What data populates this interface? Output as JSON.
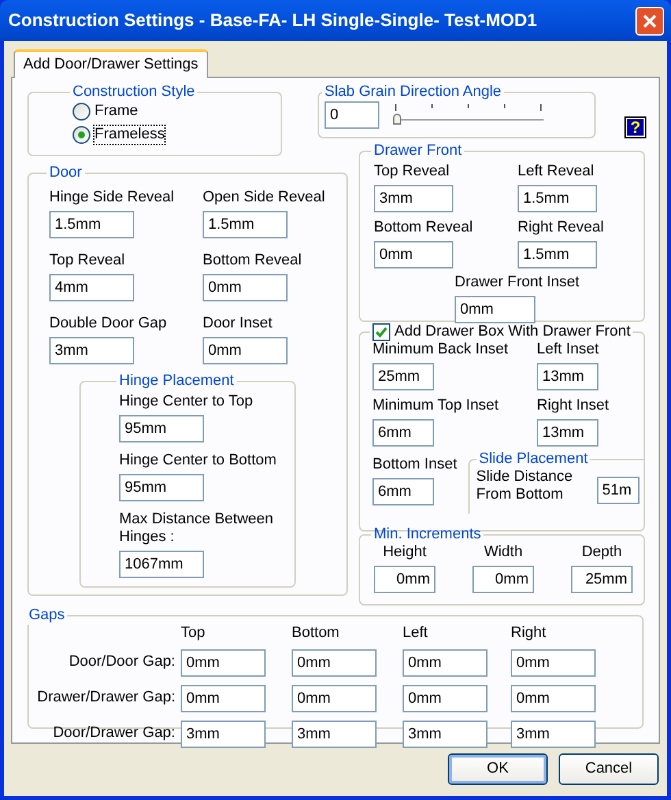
{
  "window": {
    "title": "Construction Settings - Base-FA- LH Single-Single- Test-MOD1"
  },
  "tabs": [
    {
      "label": "Add Door/Drawer Settings",
      "selected": true
    }
  ],
  "construction_style": {
    "title": "Construction Style",
    "options": [
      {
        "label": "Frame",
        "selected": false
      },
      {
        "label": "Frameless",
        "selected": true
      }
    ]
  },
  "slab_grain": {
    "title": "Slab Grain Direction Angle",
    "value": "0",
    "level": 0
  },
  "help_button": {
    "label": "?"
  },
  "door": {
    "title": "Door",
    "fields": [
      {
        "label": "Hinge Side Reveal",
        "value": "1.5mm"
      },
      {
        "label": "Open Side Reveal",
        "value": "1.5mm"
      },
      {
        "label": "Top Reveal",
        "value": "4mm"
      },
      {
        "label": "Bottom Reveal",
        "value": "0mm"
      },
      {
        "label": "Double Door Gap",
        "value": "3mm"
      },
      {
        "label": "Door Inset",
        "value": "0mm"
      }
    ],
    "hinge_placement": {
      "title": "Hinge Placement",
      "fields": [
        {
          "label": "Hinge Center to Top",
          "value": "95mm"
        },
        {
          "label": "Hinge Center to Bottom",
          "value": "95mm"
        },
        {
          "label": "Max Distance Between Hinges :",
          "value": "1067mm"
        }
      ]
    }
  },
  "drawer_front": {
    "title": "Drawer Front",
    "fields": [
      {
        "label": "Top Reveal",
        "value": "3mm"
      },
      {
        "label": "Left Reveal",
        "value": "1.5mm"
      },
      {
        "label": "Bottom Reveal",
        "value": "0mm"
      },
      {
        "label": "Right Reveal",
        "value": "1.5mm"
      }
    ],
    "inset": {
      "label": "Drawer Front Inset",
      "value": "0mm"
    }
  },
  "drawer_box": {
    "label": "Add Drawer Box With Drawer Front",
    "checked": true,
    "fields": [
      {
        "label": "Minimum Back Inset",
        "value": "25mm"
      },
      {
        "label": "Left Inset",
        "value": "13mm"
      },
      {
        "label": "Minimum Top Inset",
        "value": "6mm"
      },
      {
        "label": "Right Inset",
        "value": "13mm"
      }
    ],
    "bottom_inset": {
      "label": "Bottom Inset",
      "value": "6mm"
    },
    "slide_placement": {
      "title": "Slide Placement",
      "label": "Slide Distance From Bottom",
      "value": "51m"
    }
  },
  "min_increments": {
    "title": "Min. Increments",
    "fields": [
      {
        "label": "Height",
        "value": "0mm"
      },
      {
        "label": "Width",
        "value": "0mm"
      },
      {
        "label": "Depth",
        "value": "25mm"
      }
    ]
  },
  "gaps": {
    "title": "Gaps",
    "columns": [
      "Top",
      "Bottom",
      "Left",
      "Right"
    ],
    "rows": [
      {
        "label": "Door/Door Gap:",
        "values": [
          "0mm",
          "0mm",
          "0mm",
          "0mm"
        ]
      },
      {
        "label": "Drawer/Drawer Gap:",
        "values": [
          "0mm",
          "0mm",
          "0mm",
          "0mm"
        ]
      },
      {
        "label": "Door/Drawer Gap:",
        "values": [
          "3mm",
          "3mm",
          "3mm",
          "3mm"
        ]
      }
    ]
  },
  "buttons": [
    {
      "label": "OK",
      "default": true
    },
    {
      "label": "Cancel",
      "default": false
    }
  ]
}
